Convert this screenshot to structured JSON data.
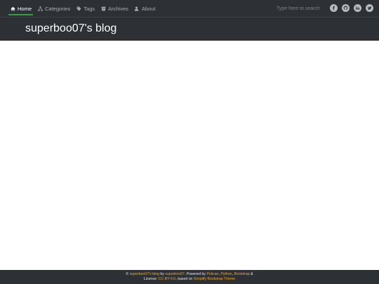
{
  "nav": {
    "items": [
      {
        "label": "Home",
        "icon": "home-icon",
        "active": true
      },
      {
        "label": "Categories",
        "icon": "sitemap-icon",
        "active": false
      },
      {
        "label": "Tags",
        "icon": "tag-icon",
        "active": false
      },
      {
        "label": "Archives",
        "icon": "archive-icon",
        "active": false
      },
      {
        "label": "About",
        "icon": "user-icon",
        "active": false
      }
    ],
    "search_placeholder": "Type here to search",
    "social": [
      "facebook-icon",
      "github-icon",
      "linkedin-icon",
      "twitter-icon"
    ]
  },
  "header": {
    "title": "superboo07's blog"
  },
  "footer": {
    "copyright_symbol": "©",
    "blog_link": "superboo07's blog",
    "by": "by",
    "author_link": "superboo07",
    "powered_by": ". Powered by",
    "pelican_link": "Pelican",
    "comma1": ",",
    "python_link": "Python",
    "comma2": ",",
    "bootstrap_link": "Bootstrap",
    "amp": "&",
    "license_label": "License:",
    "license_link": "CC-BY-4.0",
    "based_on": ", based on",
    "theme_link": "Simplify Bootstrap Theme"
  },
  "colors": {
    "navbar_bg": "#2d3034",
    "active_underline": "#2f9e44",
    "link_accent": "#f0a92a"
  }
}
